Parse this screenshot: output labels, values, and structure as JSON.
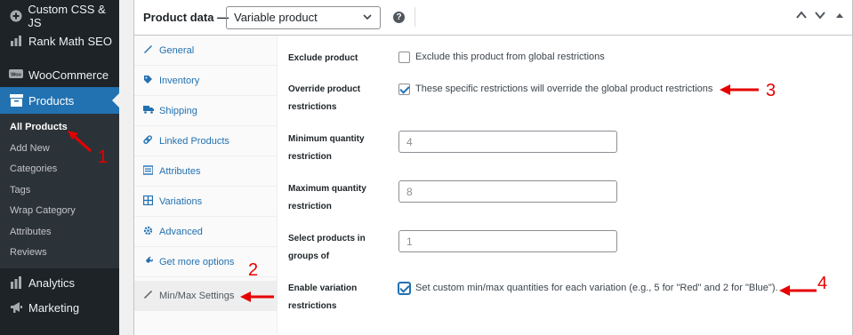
{
  "sidebar": {
    "items": [
      {
        "label": "Custom CSS & JS",
        "icon": "plus-circle-icon"
      },
      {
        "label": "Rank Math SEO",
        "icon": "chart-bars-icon"
      },
      {
        "label": "WooCommerce",
        "icon": "woocommerce-icon"
      },
      {
        "label": "Products",
        "icon": "archive-icon"
      },
      {
        "label": "Analytics",
        "icon": "bar-chart-icon"
      },
      {
        "label": "Marketing",
        "icon": "megaphone-icon"
      }
    ],
    "submenu": [
      "All Products",
      "Add New",
      "Categories",
      "Tags",
      "Wrap Category",
      "Attributes",
      "Reviews"
    ]
  },
  "header": {
    "title": "Product data —",
    "product_type": "Variable product",
    "help": "?"
  },
  "tabs": [
    {
      "label": "General",
      "icon": "wrench-icon"
    },
    {
      "label": "Inventory",
      "icon": "tag-icon"
    },
    {
      "label": "Shipping",
      "icon": "truck-icon"
    },
    {
      "label": "Linked Products",
      "icon": "link-icon"
    },
    {
      "label": "Attributes",
      "icon": "list-icon"
    },
    {
      "label": "Variations",
      "icon": "grid-icon"
    },
    {
      "label": "Advanced",
      "icon": "gear-icon"
    },
    {
      "label": "Get more options",
      "icon": "plugin-icon"
    },
    {
      "label": "Min/Max Settings",
      "icon": "wrench-icon"
    }
  ],
  "fields": {
    "exclude": {
      "label": "Exclude product",
      "text": "Exclude this product from global restrictions",
      "checked": false
    },
    "override": {
      "label_1": "Override product",
      "label_2": "restrictions",
      "text": "These specific restrictions will override the global product restrictions",
      "checked": true
    },
    "min_qty": {
      "label_1": "Minimum quantity",
      "label_2": "restriction",
      "placeholder": "4"
    },
    "max_qty": {
      "label_1": "Maximum quantity",
      "label_2": "restriction",
      "placeholder": "8"
    },
    "groups": {
      "label_1": "Select products in",
      "label_2": "groups of",
      "placeholder": "1"
    },
    "variation": {
      "label_1": "Enable variation",
      "label_2": "restrictions",
      "text": "Set custom min/max quantities for each variation (e.g., 5 for \"Red\" and 2 for \"Blue\").",
      "checked": true
    }
  },
  "annotations": [
    "1",
    "2",
    "3",
    "4"
  ],
  "colors": {
    "accent": "#2271b1",
    "annotation": "#e60000",
    "sidebar": "#1d2327"
  }
}
